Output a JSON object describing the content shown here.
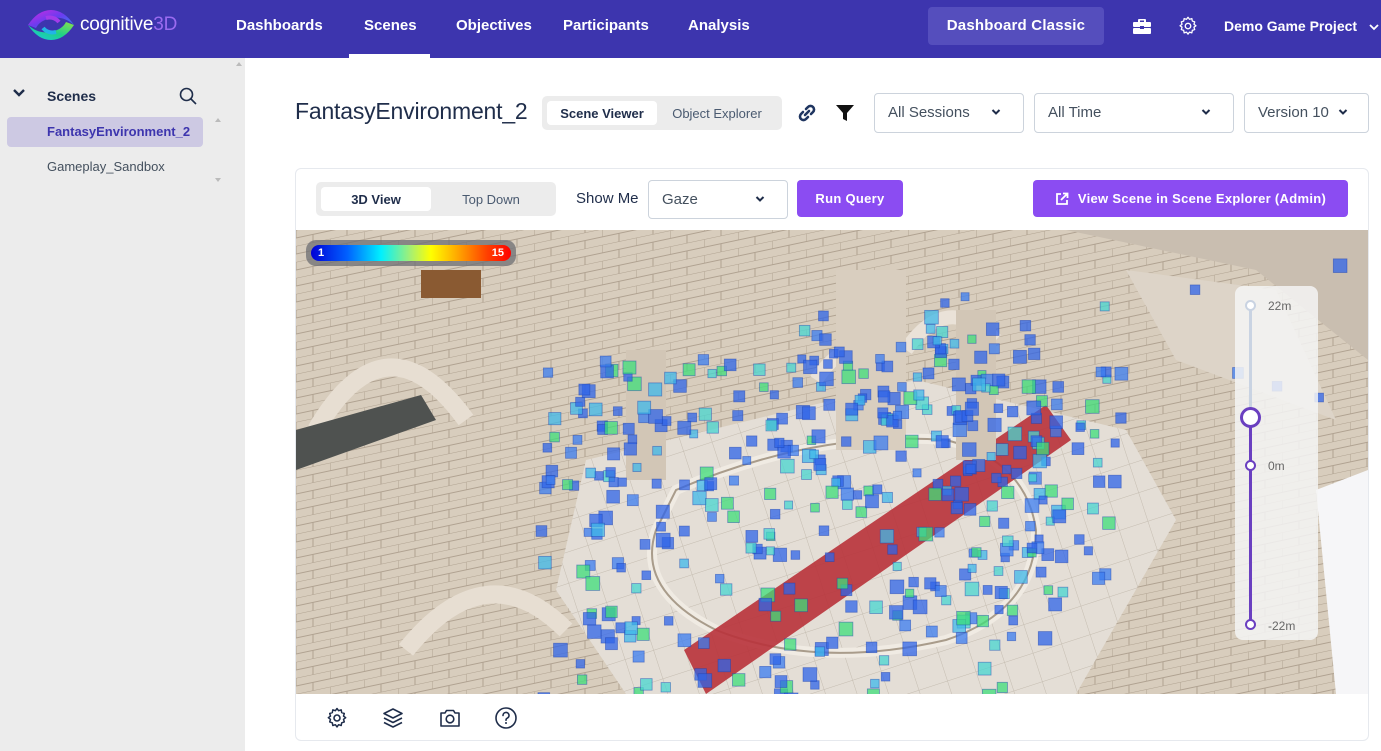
{
  "app": {
    "logo_text": "cognitive",
    "logo_accent": "3D",
    "brand_color": "#3d35ae",
    "accent_color": "#8b4cf2"
  },
  "nav": {
    "items": [
      {
        "label": "Dashboards",
        "active": false
      },
      {
        "label": "Scenes",
        "active": true
      },
      {
        "label": "Objectives",
        "active": false
      },
      {
        "label": "Participants",
        "active": false
      },
      {
        "label": "Analysis",
        "active": false
      }
    ],
    "classic_button": "Dashboard Classic",
    "toolbox_icon": "toolbox-icon",
    "settings_icon": "gear-icon",
    "project": "Demo Game Project"
  },
  "sidebar": {
    "title": "Scenes",
    "items": [
      {
        "label": "FantasyEnvironment_2",
        "active": true
      },
      {
        "label": "Gameplay_Sandbox",
        "active": false
      }
    ]
  },
  "header": {
    "scene_title": "FantasyEnvironment_2",
    "tabs": [
      {
        "label": "Scene Viewer",
        "active": true
      },
      {
        "label": "Object Explorer",
        "active": false
      }
    ],
    "link_icon": "link-icon",
    "filter_icon": "filter-icon",
    "sessions_dropdown": "All Sessions",
    "time_dropdown": "All Time",
    "version_dropdown": "Version 10"
  },
  "viewer": {
    "view_tabs": [
      {
        "label": "3D View",
        "active": true
      },
      {
        "label": "Top Down",
        "active": false
      }
    ],
    "show_me_label": "Show Me",
    "show_me_value": "Gaze",
    "run_query": "Run Query",
    "scene_explorer_button": "View Scene in Scene Explorer (Admin)",
    "legend": {
      "min": "1",
      "max": "15"
    },
    "height_slider": {
      "max_label": "22m",
      "mid_label": "0m",
      "min_label": "-22m",
      "current_value_m": 6.5
    },
    "toolbar_icons": [
      "gear-icon",
      "layers-icon",
      "camera-icon",
      "help-icon"
    ]
  }
}
